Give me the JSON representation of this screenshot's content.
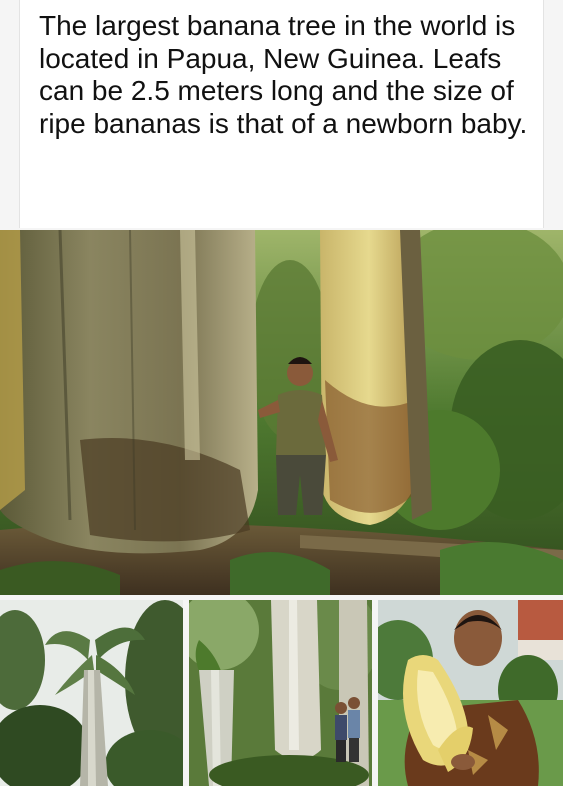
{
  "post": {
    "caption": "The largest banana tree in the world is located in Papua, New Guinea. Leafs can be 2.5 meters long and the size of ripe bananas is that of a newborn baby."
  },
  "photos": [
    {
      "name": "main-photo"
    },
    {
      "name": "photo-canopy"
    },
    {
      "name": "photo-trunks-people"
    },
    {
      "name": "photo-man-banana"
    }
  ],
  "colors": {
    "page_background": "#f5f5f5",
    "card_background": "#ffffff",
    "text": "#111111",
    "foliage": "#3f6a2a",
    "trunk": "#a89a6a"
  }
}
